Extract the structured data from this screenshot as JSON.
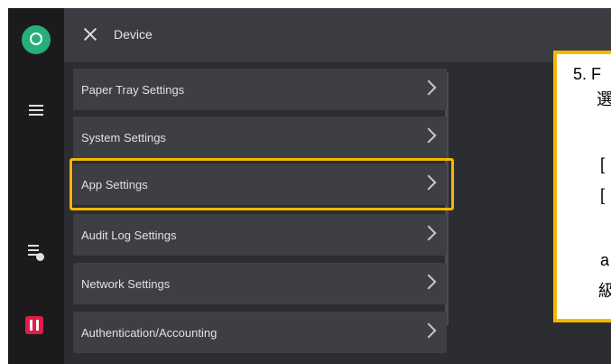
{
  "header": {
    "title": "Device"
  },
  "settings_list": [
    {
      "label": "Paper Tray Settings"
    },
    {
      "label": "System Settings"
    },
    {
      "label": "App Settings"
    },
    {
      "label": "Audit Log Settings"
    },
    {
      "label": "Network Settings"
    },
    {
      "label": "Authentication/Accounting"
    }
  ],
  "callout": {
    "line1": "5. F",
    "line2": "選",
    "line3": "[",
    "line4": "[",
    "line5": "a",
    "line6": "級"
  },
  "colors": {
    "highlight": "#f5b800",
    "avatar": "#27ae7a",
    "alert": "#e11d48"
  }
}
